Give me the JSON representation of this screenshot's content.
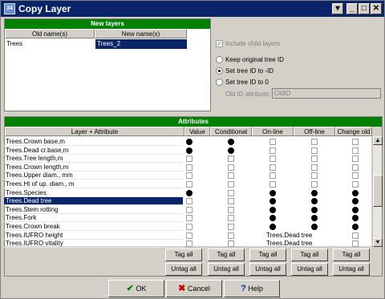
{
  "window": {
    "title": "Copy Layer",
    "app_icon_label": "34",
    "buttons": [
      "▾",
      "_",
      "□",
      "✕"
    ]
  },
  "new_layers": {
    "header": "New layers",
    "columns": [
      "Old name(s)",
      "New name(s)"
    ],
    "rows": [
      {
        "old": "Trees",
        "new": "Trees_2"
      }
    ]
  },
  "options": {
    "include_child_layers": {
      "label": "Include child layers",
      "checked": true,
      "enabled": false
    },
    "tree_id_radios": [
      {
        "label": "Keep original tree ID",
        "selected": false
      },
      {
        "label": "Set tree ID to -ID",
        "selected": true
      },
      {
        "label": "Set tree ID to 0",
        "selected": false
      }
    ],
    "old_id_attribute": {
      "label": "Old ID attribute:",
      "value": "OldID",
      "enabled": false
    }
  },
  "attributes": {
    "header": "Attributes",
    "columns": [
      "Layer + Attribute",
      "Value",
      "Conditional",
      "On-line",
      "Off-line",
      "Change old"
    ],
    "rows": [
      {
        "name": "Trees.Crown base,m",
        "value": true,
        "conditional": true,
        "online": false,
        "offline": false,
        "change_old": false,
        "selected": false
      },
      {
        "name": "Trees.Dead cr.base,m",
        "value": true,
        "conditional": true,
        "online": false,
        "offline": false,
        "change_old": false,
        "selected": false
      },
      {
        "name": "Trees.Tree length,m",
        "value": false,
        "conditional": false,
        "online": false,
        "offline": false,
        "change_old": false,
        "selected": false
      },
      {
        "name": "Trees.Crown length,m",
        "value": false,
        "conditional": false,
        "online": false,
        "offline": false,
        "change_old": false,
        "selected": false
      },
      {
        "name": "Trees.Upper diam., mm",
        "value": false,
        "conditional": false,
        "online": false,
        "offline": false,
        "change_old": false,
        "selected": false
      },
      {
        "name": "Trees.Ht of up. diam., m",
        "value": false,
        "conditional": false,
        "online": false,
        "offline": false,
        "change_old": false,
        "selected": false
      },
      {
        "name": "Trees.Species",
        "value": true,
        "conditional": false,
        "online": true,
        "offline": true,
        "change_old": true,
        "selected": false
      },
      {
        "name": "Trees.Dead tree",
        "value": false,
        "conditional": false,
        "online": true,
        "offline": true,
        "change_old": true,
        "selected": true
      },
      {
        "name": "Trees.Stem rotting",
        "value": false,
        "conditional": false,
        "online": true,
        "offline": true,
        "change_old": true,
        "selected": false
      },
      {
        "name": "Trees.Fork",
        "value": false,
        "conditional": false,
        "online": true,
        "offline": true,
        "change_old": true,
        "selected": false
      },
      {
        "name": "Trees.Crown break",
        "value": false,
        "conditional": false,
        "online": true,
        "offline": true,
        "change_old": true,
        "selected": false
      },
      {
        "name": "Trees.IUFRO height",
        "value": false,
        "conditional": false,
        "online_text": "Trees.Dead tree",
        "offline": false,
        "change_old": false,
        "selected": false
      },
      {
        "name": "Trees.IUFRO vitality",
        "value": false,
        "conditional": false,
        "online_text": "Trees.Dead tree",
        "offline": false,
        "change_old": false,
        "selected": false
      }
    ],
    "tag_all_label": "Tag all",
    "untag_all_label": "Untag all"
  },
  "footer": {
    "ok_label": "OK",
    "cancel_label": "Cancel",
    "help_label": "Help",
    "ok_icon_color": "#008000",
    "cancel_icon_color": "#c00000",
    "help_icon_color": "#0030c0"
  },
  "colors": {
    "header_green": "#008000",
    "selection_blue": "#0a246a",
    "dialog_gray": "#d4d0c8"
  }
}
